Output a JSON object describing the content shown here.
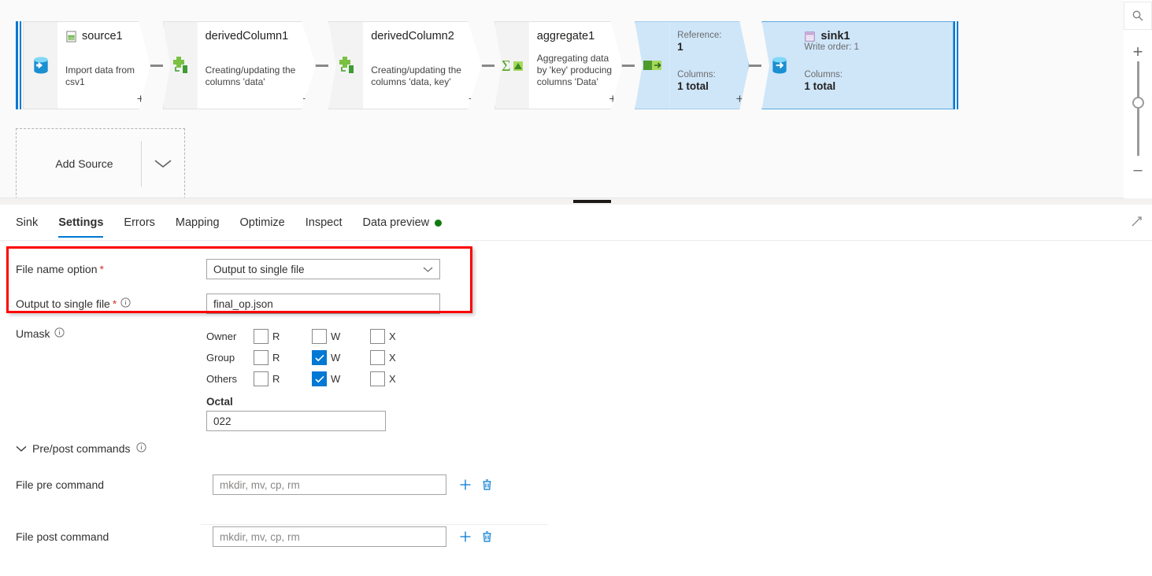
{
  "canvas": {
    "nodes": [
      {
        "id": "source1",
        "title": "source1",
        "subtitle": "Import data from csv1",
        "icon": "source-database-icon",
        "type": "source",
        "plus": "+"
      },
      {
        "id": "derivedColumn1",
        "title": "derivedColumn1",
        "subtitle": "Creating/updating the columns 'data'",
        "icon": "derived-column-icon",
        "type": "transform",
        "plus": "+"
      },
      {
        "id": "derivedColumn2",
        "title": "derivedColumn2",
        "subtitle": "Creating/updating the columns 'data, key'",
        "icon": "derived-column-icon",
        "type": "transform",
        "plus": "+"
      },
      {
        "id": "aggregate1",
        "title": "aggregate1",
        "subtitle": "Aggregating data by 'key' producing columns 'Data'",
        "icon": "aggregate-sigma-icon",
        "type": "transform",
        "plus": "+"
      }
    ],
    "reference_node": {
      "icon": "reference-icon",
      "reference_label": "Reference:",
      "reference_value": "1",
      "columns_label": "Columns:",
      "columns_value": "1 total",
      "plus": "+"
    },
    "sink_node": {
      "icon": "sink-database-icon",
      "title_icon": "sink-table-icon",
      "title": "sink1",
      "write_order": "Write order: 1",
      "columns_label": "Columns:",
      "columns_value": "1 total"
    },
    "add_source": {
      "label": "Add Source",
      "chevron": "chevron-down-icon"
    },
    "zoom_controls": {
      "search": "zoom-to-fit-icon",
      "zoom_in": "+",
      "zoom_out": "–"
    }
  },
  "panel": {
    "tabs": [
      {
        "label": "Sink",
        "active": false
      },
      {
        "label": "Settings",
        "active": true
      },
      {
        "label": "Errors",
        "active": false
      },
      {
        "label": "Mapping",
        "active": false
      },
      {
        "label": "Optimize",
        "active": false
      },
      {
        "label": "Inspect",
        "active": false
      },
      {
        "label": "Data preview",
        "active": false,
        "status_dot": "#107c10"
      }
    ],
    "expand_icon": "expand-panel-icon"
  },
  "settings": {
    "file_name_option": {
      "label": "File name option",
      "required": "*",
      "value": "Output to single file",
      "chevron": "chevron-down-icon"
    },
    "output_to_single_file": {
      "label": "Output to single file",
      "required": "*",
      "info": "info-icon",
      "value": "final_op.json"
    },
    "umask": {
      "label": "Umask",
      "info": "info-icon",
      "col_labels": [
        "R",
        "W",
        "X"
      ],
      "rows": [
        {
          "name": "Owner",
          "r": false,
          "w": false,
          "x": false
        },
        {
          "name": "Group",
          "r": false,
          "w": true,
          "x": false
        },
        {
          "name": "Others",
          "r": false,
          "w": true,
          "x": false
        }
      ],
      "octal_label": "Octal",
      "octal_value": "022"
    },
    "prepost": {
      "label": "Pre/post commands",
      "info": "info-icon",
      "chevron": "chevron-down-icon",
      "pre": {
        "label": "File pre command",
        "placeholder": "mkdir, mv, cp, rm",
        "add": "add-icon",
        "delete": "delete-icon"
      },
      "post": {
        "label": "File post command",
        "placeholder": "mkdir, mv, cp, rm",
        "add": "add-icon",
        "delete": "delete-icon"
      }
    },
    "highlight_color": "#ff0000"
  }
}
